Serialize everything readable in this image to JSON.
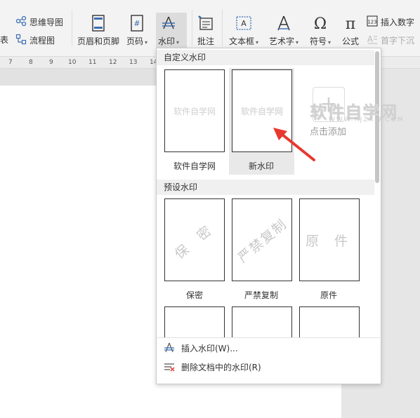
{
  "ribbon": {
    "mindmap_label": "思维导图",
    "flowchart_label": "流程图",
    "partial_label": "图表",
    "header_footer_label": "页眉和页脚",
    "page_number_label": "页码",
    "watermark_label": "水印",
    "comment_label": "批注",
    "textbox_label": "文本框",
    "wordart_label": "艺术字",
    "symbol_label": "符号",
    "formula_label": "公式",
    "insert_number_label": "插入数字",
    "dropcap_label": "首字下沉"
  },
  "ruler": {
    "ticks": [
      "7",
      "8",
      "9",
      "10",
      "11",
      "12",
      "13",
      "14"
    ]
  },
  "panel": {
    "custom_section": "自定义水印",
    "custom_items": [
      {
        "label": "软件自学网",
        "preview_text": "软件自学网"
      },
      {
        "label": "新水印",
        "preview_text": "软件自学网"
      }
    ],
    "add_label": "点击添加",
    "preset_section": "预设水印",
    "preset_items": [
      {
        "label": "保密",
        "preview_text": "保 密"
      },
      {
        "label": "严禁复制",
        "preview_text": "严禁复制"
      },
      {
        "label": "原件",
        "preview_text": "原 件"
      }
    ],
    "insert_watermark": "插入水印(W)...",
    "delete_watermark": "删除文档中的水印(R)"
  },
  "overlay": {
    "site_watermark": "软件自学网",
    "site_watermark_sub": "WWW.RJZXW.COM"
  },
  "colors": {
    "accent": "#3c6eb4",
    "arrow": "#e8382f"
  }
}
